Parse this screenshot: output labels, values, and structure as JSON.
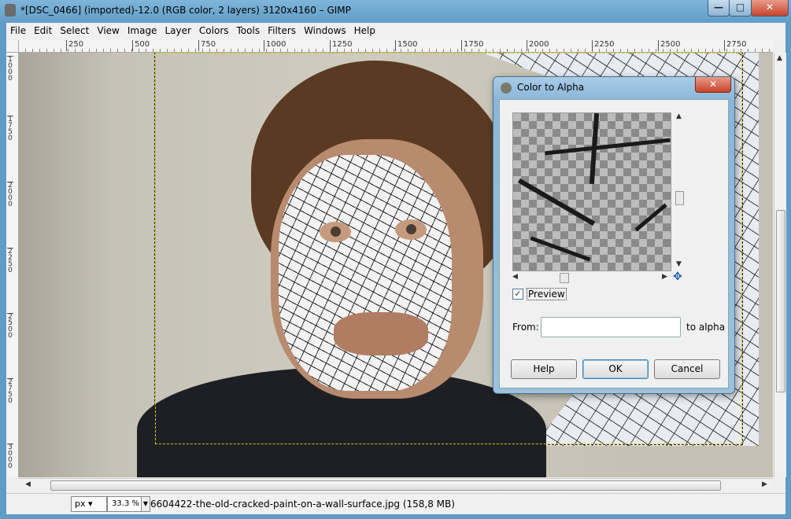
{
  "window": {
    "title": "*[DSC_0466] (imported)-12.0 (RGB color, 2 layers) 3120x4160 – GIMP",
    "minimize": "—",
    "maximize": "□",
    "close": "✕"
  },
  "menu": [
    "File",
    "Edit",
    "Select",
    "View",
    "Image",
    "Layer",
    "Colors",
    "Tools",
    "Filters",
    "Windows",
    "Help"
  ],
  "ruler": {
    "top_ticks": [
      "250",
      "500",
      "750",
      "1000",
      "1250",
      "1500",
      "1750",
      "2000",
      "2250",
      "2500",
      "2750"
    ],
    "left_ticks": [
      "1\n0\n0\n0",
      "1\n7\n5\n0",
      "2\n0\n0\n0",
      "2\n2\n5\n0",
      "2\n5\n0\n0",
      "2\n7\n5\n0",
      "3\n0\n0\n0"
    ]
  },
  "status": {
    "unit": "px",
    "zoom": "33.3 %",
    "message": "6604422-the-old-cracked-paint-on-a-wall-surface.jpg (158,8 MB)"
  },
  "dialog": {
    "title": "Color to Alpha",
    "close": "✕",
    "preview_label": "Preview",
    "preview_checked": true,
    "from_label": "From:",
    "from_value": "",
    "to_alpha_label": "to alpha",
    "help_label": "Help",
    "ok_label": "OK",
    "cancel_label": "Cancel"
  },
  "icons": {
    "nav": "navigate-icon",
    "checkbox": "checkmark-icon"
  },
  "colors": {
    "selection": "#d8c400",
    "dialog_accent": "#3c7fb1",
    "title_close": "#c8432b"
  }
}
